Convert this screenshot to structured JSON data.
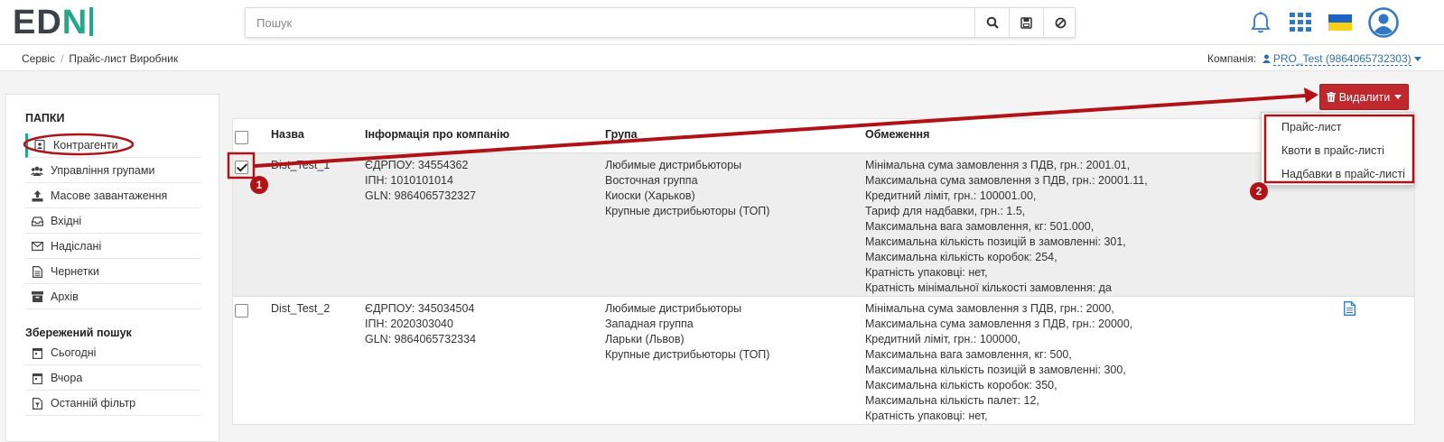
{
  "header": {
    "logo_main": "ED",
    "logo_accent": "N",
    "search": {
      "placeholder": "Пошук"
    },
    "icons": [
      "search-icon",
      "save-icon",
      "clear-icon",
      "bell-icon",
      "apps-grid-icon",
      "ukraine-flag-icon",
      "user-avatar-icon"
    ]
  },
  "breadcrumb": {
    "items": [
      "Сервіс",
      "Прайс-лист Виробник"
    ],
    "company_label": "Компанія:",
    "company_value": "PRO_Test (9864065732303)"
  },
  "sidebar": {
    "folders_title": "ПАПКИ",
    "items": [
      {
        "label": "Контрагенти",
        "icon": "contacts-icon"
      },
      {
        "label": "Управління групами",
        "icon": "group-icon"
      },
      {
        "label": "Масове завантаження",
        "icon": "upload-icon"
      },
      {
        "label": "Вхідні",
        "icon": "inbox-icon"
      },
      {
        "label": "Надіслані",
        "icon": "envelope-icon"
      },
      {
        "label": "Чернетки",
        "icon": "draft-icon"
      },
      {
        "label": "Архів",
        "icon": "archive-icon"
      }
    ],
    "saved_title": "Збережений пошук",
    "saved_items": [
      {
        "label": "Сьогодні",
        "icon": "calendar-icon"
      },
      {
        "label": "Вчора",
        "icon": "calendar-icon"
      },
      {
        "label": "Останній фільтр",
        "icon": "filter-doc-icon"
      }
    ]
  },
  "actions": {
    "delete_label": "Видалити",
    "dropdown": [
      "Прайс-лист",
      "Квоти в прайс-листі",
      "Надбавки в прайс-листі"
    ]
  },
  "table": {
    "columns": [
      "Назва",
      "Інформація про компанію",
      "Група",
      "Обмеження"
    ],
    "rows": [
      {
        "name": "Dist_Test_1",
        "checked": true,
        "info": [
          "ЄДРПОУ: 34554362",
          "ІПН: 1010101014",
          "GLN: 9864065732327"
        ],
        "groups": [
          "Любимые дистрибьюторы",
          "Восточная группа",
          "Киоски (Харьков)",
          "Крупные дистрибьюторы (ТОП)"
        ],
        "limits": [
          "Мінімальна сума замовлення з ПДВ, грн.: 2001.01,",
          "Максимальна сума замовлення з ПДВ, грн.: 20001.11,",
          "Кредитний ліміт, грн.: 100001.00,",
          "Тариф для надбавки, грн.: 1.5,",
          "Максимальна вага замовлення, кг: 501.000,",
          "Максимальна кількість позицій в замовленні: 301,",
          "Максимальна кількість коробок: 254,",
          "Кратність упаковці: нет,",
          "Кратність мінімальної кількості замовлення: да"
        ]
      },
      {
        "name": "Dist_Test_2",
        "checked": false,
        "info": [
          "ЄДРПОУ: 345034504",
          "ІПН: 2020303040",
          "GLN: 9864065732334"
        ],
        "groups": [
          "Любимые дистрибьюторы",
          "Западная группа",
          "Ларьки (Львов)",
          "Крупные дистрибьюторы (ТОП)"
        ],
        "limits": [
          "Мінімальна сума замовлення з ПДВ, грн.: 2000,",
          "Максимальна сума замовлення з ПДВ, грн.: 20000,",
          "Кредитний ліміт, грн.: 100000,",
          "Максимальна вага замовлення, кг: 500,",
          "Максимальна кількість позицій в замовленні: 300,",
          "Максимальна кількість коробок: 350,",
          "Максимальна кількість палет: 12,",
          "Кратність упаковці: нет,"
        ],
        "doc_icon": "document-icon"
      }
    ]
  },
  "annotations": {
    "badge1": "1",
    "badge2": "2",
    "color": "#b01217"
  },
  "colors": {
    "accent": "#1faa8a",
    "danger": "#c0282e",
    "link": "#2f6fb3"
  }
}
